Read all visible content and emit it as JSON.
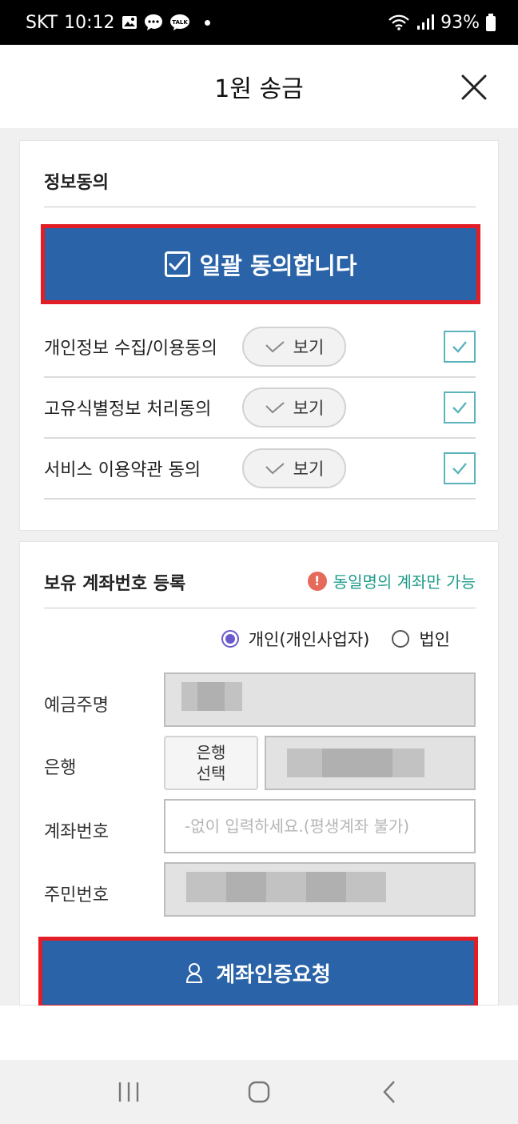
{
  "status_bar": {
    "carrier": "SKT",
    "time": "10:12",
    "talk_badge": "TALK",
    "battery": "93%"
  },
  "header": {
    "title": "1원 송금"
  },
  "consent": {
    "title": "정보동의",
    "agree_all_label": "일괄 동의합니다",
    "view_label": "보기",
    "items": [
      {
        "label": "개인정보 수집/이용동의",
        "checked": true
      },
      {
        "label": "고유식별정보 처리동의",
        "checked": true
      },
      {
        "label": "서비스 이용약관 동의",
        "checked": true
      }
    ]
  },
  "account": {
    "title": "보유 계좌번호 등록",
    "notice": "동일명의 계좌만 가능",
    "account_type": {
      "options": [
        "개인(개인사업자)",
        "법인"
      ],
      "selected": "개인(개인사업자)"
    },
    "labels": {
      "holder": "예금주명",
      "bank": "은행",
      "account_number": "계좌번호",
      "resident_number": "주민번호"
    },
    "bank_select_line1": "은행",
    "bank_select_line2": "선택",
    "account_placeholder": "-없이 입력하세요.(평생계좌 불가)",
    "submit_label": "계좌인증요청"
  },
  "colors": {
    "primary_button": "#2a63a8",
    "highlight_border": "#e31d25",
    "checkbox_border": "#5db3bd",
    "notice_text": "#1e9b8a",
    "notice_icon": "#e56a5a",
    "radio_selected": "#6a5acd"
  }
}
